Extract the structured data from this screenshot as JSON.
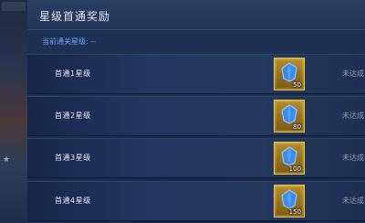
{
  "panel": {
    "title": "星级首通奖励",
    "current_level_label": "当前通关星级:",
    "current_level_value": "--"
  },
  "rows": [
    {
      "label": "首通1星级",
      "reward_qty": "50",
      "status": "未达成"
    },
    {
      "label": "首通2星级",
      "reward_qty": "80",
      "status": "未达成"
    },
    {
      "label": "首通3星级",
      "reward_qty": "100",
      "status": "未达成"
    },
    {
      "label": "首通4星级",
      "reward_qty": "150",
      "status": "未达成"
    }
  ],
  "reward_icon": "blue-gem-icon",
  "colors": {
    "accent": "#5fa8ff",
    "reward_frame": "#c9a132",
    "gem": "#3a8cf0",
    "status_text": "#8d9ab0"
  }
}
